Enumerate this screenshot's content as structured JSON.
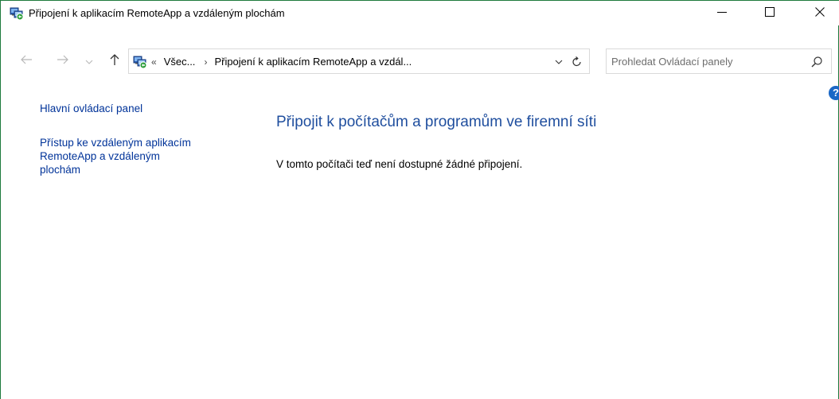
{
  "window": {
    "title": "Připojení k aplikacím RemoteApp a vzdáleným plochám",
    "icon": "remoteapp-icon",
    "controls": {
      "minimize": "minimize-icon",
      "maximize": "maximize-icon",
      "close": "close-icon"
    }
  },
  "address_bar": {
    "overflow_chevron": "«",
    "breadcrumbs": [
      {
        "label": "Všec..."
      },
      {
        "label": "Připojení k aplikacím RemoteApp a vzdál..."
      }
    ],
    "separator": "›"
  },
  "search": {
    "placeholder": "Prohledat Ovládací panely"
  },
  "sidebar": {
    "items": [
      {
        "label": "Hlavní ovládací panel"
      },
      {
        "label": "Přístup ke vzdáleným aplikacím RemoteApp a vzdáleným plochám"
      }
    ]
  },
  "main": {
    "title": "Připojit k počítačům a programům ve firemní síti",
    "message": "V tomto počítači teď není dostupné žádné připojení."
  },
  "colors": {
    "border": "#1e7a3c",
    "link": "#003399",
    "heading": "#1f4e9e",
    "help": "#1a67c6"
  }
}
